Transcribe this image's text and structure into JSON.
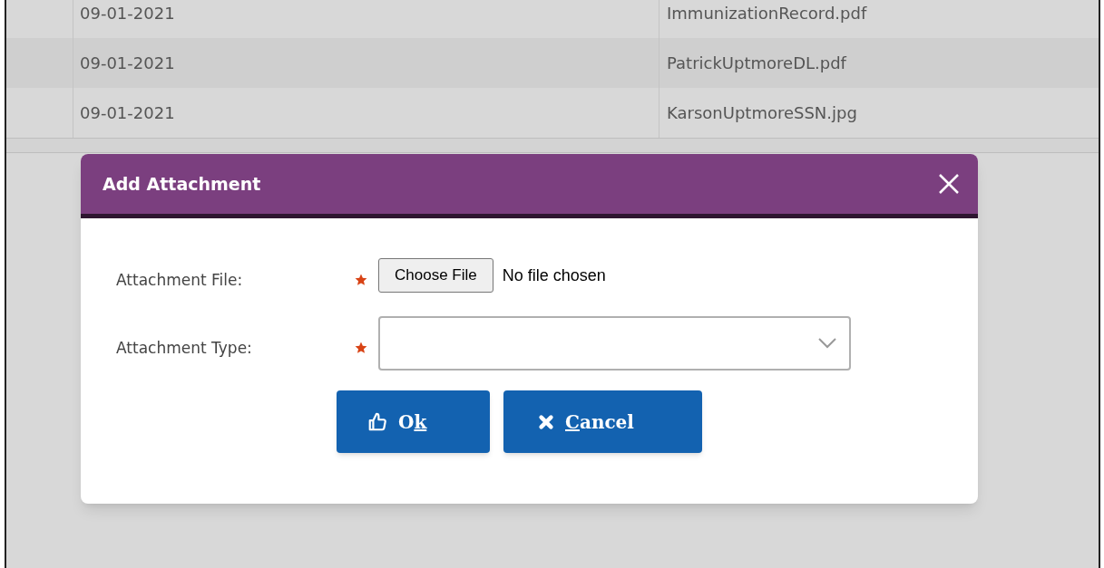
{
  "table": {
    "rows": [
      {
        "date": "09-01-2021",
        "file": "ImmunizationRecord.pdf"
      },
      {
        "date": "09-01-2021",
        "file": "PatrickUptmoreDL.pdf"
      },
      {
        "date": "09-01-2021",
        "file": "KarsonUptmoreSSN.jpg"
      }
    ]
  },
  "dialog": {
    "title": "Add Attachment",
    "fields": [
      {
        "kind": "file",
        "label": "Attachment File:",
        "required": true,
        "button": "Choose File",
        "status": "No file chosen"
      },
      {
        "kind": "select",
        "label": "Attachment Type:",
        "required": true
      }
    ],
    "buttons": [
      {
        "kind": "ok",
        "before": "O",
        "key": "k"
      },
      {
        "kind": "cancel",
        "key": "C",
        "after": "ancel"
      }
    ]
  }
}
